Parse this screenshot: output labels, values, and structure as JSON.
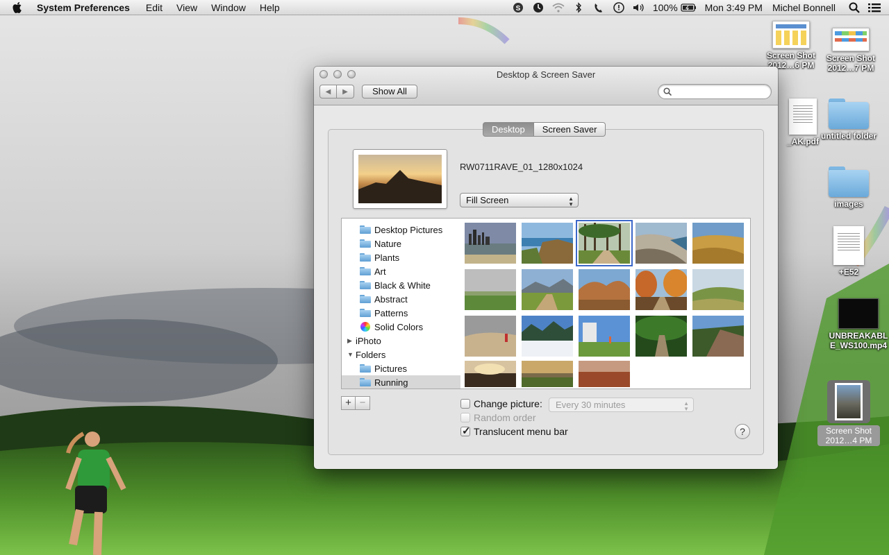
{
  "menubar": {
    "app_name": "System Preferences",
    "menus": [
      "Edit",
      "View",
      "Window",
      "Help"
    ],
    "battery": "100%",
    "clock": "Mon 3:49 PM",
    "user": "Michel Bonnell"
  },
  "desktop_icons": [
    {
      "label": "Screen Shot 2012…6 PM",
      "icon": "screenshot-thumb-icon"
    },
    {
      "label": "Screen Shot 2012…7 PM",
      "icon": "screenshot-thumb-icon"
    },
    {
      "label": "_AK.pdf",
      "icon": "pdf-document-icon"
    },
    {
      "label": "untitled folder",
      "icon": "folder-icon"
    },
    {
      "label": "images",
      "icon": "folder-icon"
    },
    {
      "label": "+E52",
      "icon": "spreadsheet-document-icon"
    },
    {
      "label": "UNBREAKABLE_WS100.mp4",
      "icon": "video-file-icon"
    },
    {
      "label": "Screen Shot 2012…4 PM",
      "icon": "screenshot-thumb-icon"
    }
  ],
  "window": {
    "title": "Desktop & Screen Saver",
    "show_all": "Show All",
    "search_placeholder": "",
    "tabs": [
      {
        "label": "Desktop",
        "active": true
      },
      {
        "label": "Screen Saver",
        "active": false
      }
    ],
    "current_picture": "RW0711RAVE_01_1280x1024",
    "fit_mode": "Fill Screen",
    "sources": [
      {
        "label": "Desktop Pictures",
        "type": "folder"
      },
      {
        "label": "Nature",
        "type": "folder"
      },
      {
        "label": "Plants",
        "type": "folder"
      },
      {
        "label": "Art",
        "type": "folder"
      },
      {
        "label": "Black & White",
        "type": "folder"
      },
      {
        "label": "Abstract",
        "type": "folder"
      },
      {
        "label": "Patterns",
        "type": "folder"
      },
      {
        "label": "Solid Colors",
        "type": "colors"
      },
      {
        "label": "iPhoto",
        "type": "group-collapsed"
      },
      {
        "label": "Folders",
        "type": "group-expanded"
      },
      {
        "label": "Pictures",
        "type": "folder"
      },
      {
        "label": "Running",
        "type": "folder",
        "selected": true
      }
    ],
    "selected_thumbnail": 3,
    "thumbnail_count": 18,
    "change_picture": {
      "label": "Change picture:",
      "checked": false
    },
    "interval": "Every 30 minutes",
    "random_order": {
      "label": "Random order",
      "checked": false,
      "disabled": true
    },
    "translucent_menu_bar": {
      "label": "Translucent menu bar",
      "checked": true
    },
    "add": "+",
    "remove": "−",
    "help": "?"
  },
  "colors": {
    "selection_outline": "#3b67c9",
    "window_bg": "#e8e8e8"
  }
}
